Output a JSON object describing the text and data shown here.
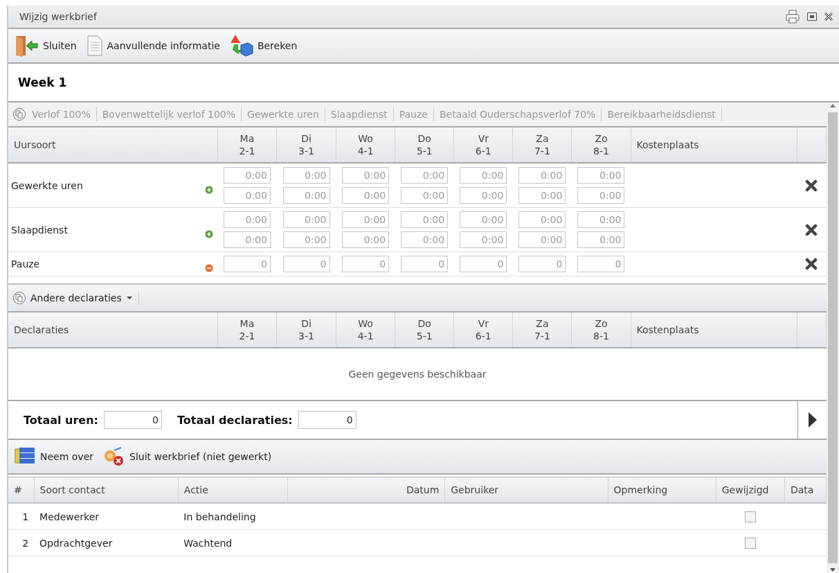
{
  "window": {
    "title": "Wijzig werkbrief"
  },
  "toolbar": [
    {
      "kind": "close",
      "label": "Sluiten"
    },
    {
      "kind": "document",
      "label": "Aanvullende informatie"
    },
    {
      "kind": "calculate",
      "label": "Bereken"
    }
  ],
  "week": {
    "title": "Week 1"
  },
  "type_tabs": [
    "Verlof 100%",
    "Bovenwettelijk verlof 100%",
    "Gewerkte uren",
    "Slaapdienst",
    "Pauze",
    "Betaald Ouderschapsverlof 70%",
    "Bereikbaarheidsdienst"
  ],
  "hours_table": {
    "columns": [
      {
        "label": "Uursoort"
      },
      {
        "day": "Ma",
        "date": "2-1"
      },
      {
        "day": "Di",
        "date": "3-1"
      },
      {
        "day": "Wo",
        "date": "4-1"
      },
      {
        "day": "Do",
        "date": "5-1"
      },
      {
        "day": "Vr",
        "date": "6-1"
      },
      {
        "day": "Za",
        "date": "7-1"
      },
      {
        "day": "Zo",
        "date": "8-1"
      },
      {
        "label": "Kostenplaats"
      }
    ],
    "rows": [
      {
        "name": "Gewerkte uren",
        "kind": "plus",
        "entries": [
          [
            "0:00",
            "0:00",
            "0:00",
            "0:00",
            "0:00",
            "0:00",
            "0:00"
          ],
          [
            "0:00",
            "0:00",
            "0:00",
            "0:00",
            "0:00",
            "0:00",
            "0:00"
          ]
        ]
      },
      {
        "name": "Slaapdienst",
        "kind": "plus",
        "entries": [
          [
            "0:00",
            "0:00",
            "0:00",
            "0:00",
            "0:00",
            "0:00",
            "0:00"
          ],
          [
            "0:00",
            "0:00",
            "0:00",
            "0:00",
            "0:00",
            "0:00",
            "0:00"
          ]
        ]
      },
      {
        "name": "Pauze",
        "kind": "minus",
        "entries": [
          [
            "0",
            "0",
            "0",
            "0",
            "0",
            "0",
            "0"
          ]
        ]
      }
    ]
  },
  "declarations_menu": {
    "label": "Andere declaraties"
  },
  "declarations_table": {
    "columns": [
      {
        "label": "Declaraties"
      },
      {
        "day": "Ma",
        "date": "2-1"
      },
      {
        "day": "Di",
        "date": "3-1"
      },
      {
        "day": "Wo",
        "date": "4-1"
      },
      {
        "day": "Do",
        "date": "5-1"
      },
      {
        "day": "Vr",
        "date": "6-1"
      },
      {
        "day": "Za",
        "date": "7-1"
      },
      {
        "day": "Zo",
        "date": "8-1"
      },
      {
        "label": "Kostenplaats"
      }
    ],
    "empty_text": "Geen gegevens beschikbaar"
  },
  "totals": [
    {
      "label": "Totaal uren:",
      "value": "0"
    },
    {
      "label": "Totaal declaraties:",
      "value": "0"
    }
  ],
  "actions": [
    {
      "kind": "take_over",
      "label": "Neem over"
    },
    {
      "kind": "close_letter",
      "label": "Sluit werkbrief (niet gewerkt)"
    }
  ],
  "contacts_table": {
    "columns": [
      "#",
      "Soort contact",
      "Actie",
      "Datum",
      "Gebruiker",
      "Opmerking",
      "Gewijzigd",
      "Data"
    ],
    "rows": [
      {
        "number": "1",
        "contact": "Medewerker",
        "action": "In behandeling",
        "changed": false
      },
      {
        "number": "2",
        "contact": "Opdrachtgever",
        "action": "Wachtend",
        "changed": false
      }
    ]
  }
}
